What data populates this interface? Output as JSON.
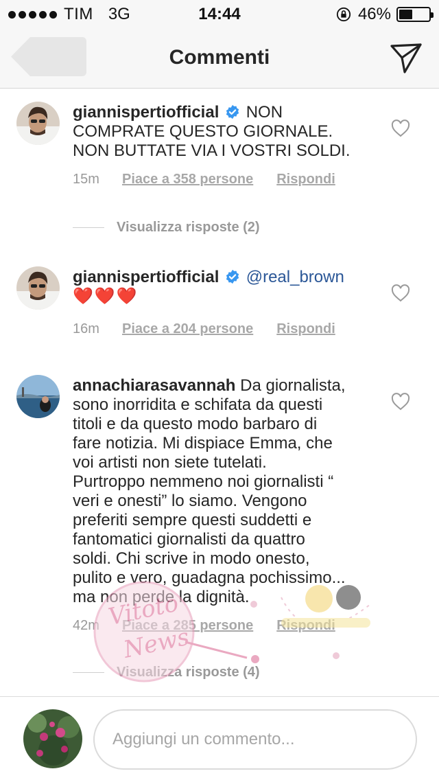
{
  "status_bar": {
    "carrier": "TIM",
    "network": "3G",
    "time": "14:44",
    "battery_percent": "46%",
    "battery_level": 0.46
  },
  "nav": {
    "title": "Commenti",
    "back_icon": "back-arrow-icon",
    "send_icon": "paper-plane-icon"
  },
  "comments": [
    {
      "username": "giannispertiofficial",
      "verified": true,
      "text_lines": [
        "NON",
        "COMPRATE QUESTO GIORNALE.",
        "NON BUTTATE VIA I VOSTRI SOLDI."
      ],
      "time": "15m",
      "likes": "Piace a 358 persone",
      "reply": "Rispondi",
      "view_replies": "Visualizza risposte (2)"
    },
    {
      "username": "giannispertiofficial",
      "verified": true,
      "mention": "@real_brown",
      "hearts": "❤️❤️❤️",
      "time": "16m",
      "likes": "Piace a 204 persone",
      "reply": "Rispondi"
    },
    {
      "username": "annachiarasavannah",
      "verified": false,
      "text_lines": [
        "Da giornalista,",
        "sono inorridita e schifata da questi",
        "titoli e da questo modo barbaro di",
        "fare notizia. Mi dispiace Emma, che",
        "voi artisti non siete tutelati.",
        "Purtroppo nemmeno noi giornalisti “",
        "veri e onesti” lo siamo. Vengono",
        "preferiti sempre questi suddetti e",
        "fantomatici giornalisti da quattro",
        "soldi. Chi scrive in modo onesto,",
        "pulito e vero, guadagna pochissimo...",
        "ma non perde la dignità."
      ],
      "time": "42m",
      "likes": "Piace a 285 persone",
      "reply": "Rispondi",
      "view_replies": "Visualizza risposte (4)"
    }
  ],
  "composer": {
    "placeholder": "Aggiungi un commento...",
    "value": ""
  },
  "watermark": {
    "text_line1": "Vitoto",
    "text_line2": "News"
  },
  "colors": {
    "accent_verified": "#3897f0",
    "mention": "#2b5797",
    "heart_red": "#e0202b",
    "muted_text": "#999999"
  }
}
